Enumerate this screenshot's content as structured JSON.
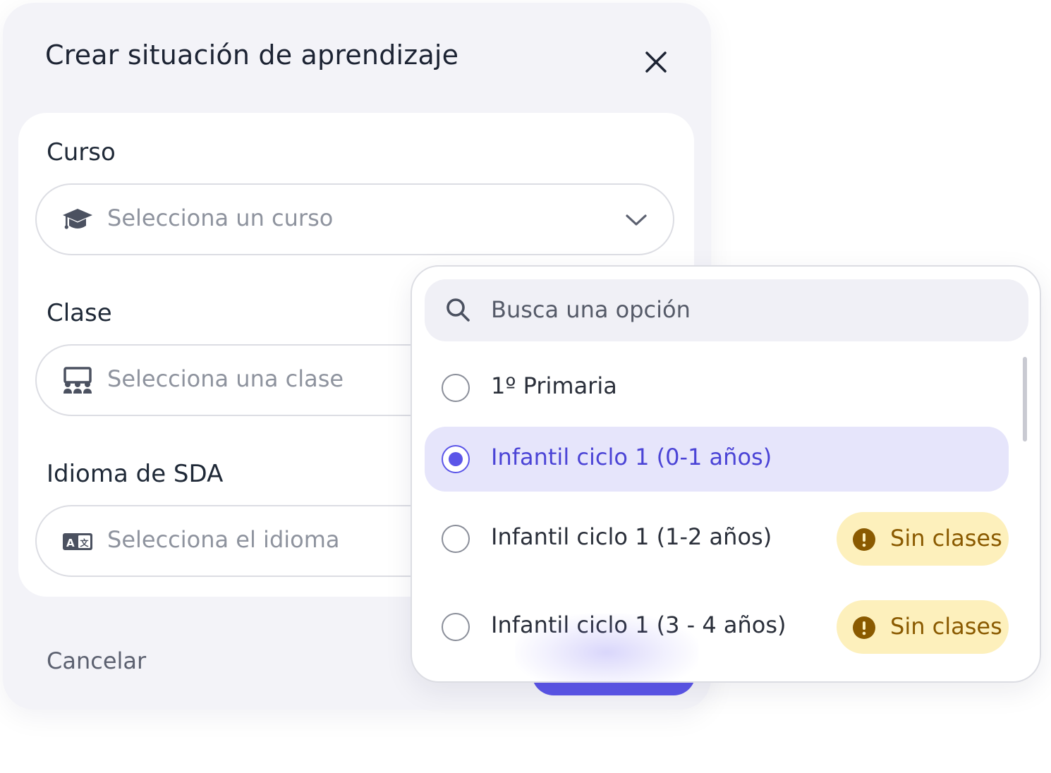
{
  "modal": {
    "title": "Crear situación de aprendizaje",
    "close_icon": "close-icon"
  },
  "form": {
    "curso": {
      "label": "Curso",
      "placeholder": "Selecciona un curso",
      "icon": "graduation-cap-icon"
    },
    "clase": {
      "label": "Clase",
      "placeholder": "Selecciona una clase",
      "icon": "classroom-icon"
    },
    "idioma": {
      "label": "Idioma de SDA",
      "placeholder": "Selecciona el idioma",
      "icon": "translate-icon"
    }
  },
  "footer": {
    "cancel_label": "Cancelar"
  },
  "dropdown": {
    "search_placeholder": "Busca una opción",
    "options": [
      {
        "label": "1º Primaria",
        "selected": false,
        "badge": ""
      },
      {
        "label": "Infantil ciclo 1 (0-1 años)",
        "selected": true,
        "badge": ""
      },
      {
        "label": "Infantil ciclo 1 (1-2 años)",
        "selected": false,
        "badge": "Sin clases"
      },
      {
        "label": "Infantil ciclo 1 (3 - 4 años)",
        "selected": false,
        "badge": "Sin clases"
      }
    ]
  },
  "colors": {
    "accent": "#5b55e8",
    "selected_bg": "#e6e5fb",
    "badge_bg": "#fdf0bc",
    "badge_text": "#8a5a00"
  }
}
